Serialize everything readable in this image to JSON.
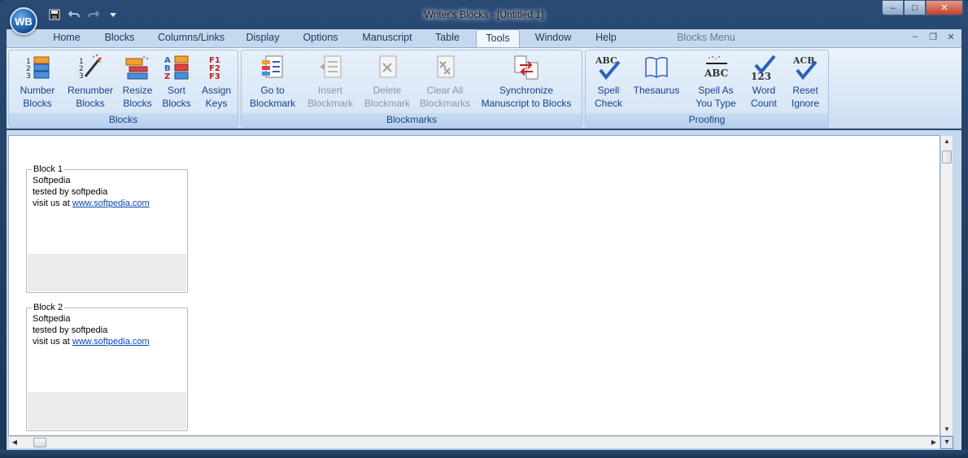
{
  "window": {
    "title": "Writer's Blocks - [Untitled 1]",
    "logo_text": "WB"
  },
  "quick_access": {
    "save_icon": "floppy-disk-icon",
    "undo_icon": "undo-arrow-icon",
    "redo_icon": "redo-arrow-icon",
    "customize_icon": "dropdown-arrow-icon"
  },
  "window_controls": {
    "minimize": "–",
    "maximize": "□",
    "close": "✕"
  },
  "tabs": [
    {
      "label": "Home"
    },
    {
      "label": "Blocks"
    },
    {
      "label": "Columns/Links"
    },
    {
      "label": "Display"
    },
    {
      "label": "Options"
    },
    {
      "label": "Manuscript"
    },
    {
      "label": "Table"
    },
    {
      "label": "Tools",
      "active": true
    },
    {
      "label": "Window"
    },
    {
      "label": "Help"
    },
    {
      "label": "Blocks Menu",
      "contextual": true
    }
  ],
  "mdi_controls": {
    "minimize": "–",
    "restore": "❐",
    "close": "✕"
  },
  "ribbon": {
    "groups": [
      {
        "label": "Blocks",
        "buttons": [
          {
            "line1": "Number",
            "line2": "Blocks",
            "icon": "number-blocks-icon"
          },
          {
            "line1": "Renumber",
            "line2": "Blocks",
            "icon": "renumber-blocks-icon"
          },
          {
            "line1": "Resize",
            "line2": "Blocks",
            "icon": "resize-blocks-icon"
          },
          {
            "line1": "Sort",
            "line2": "Blocks",
            "icon": "sort-blocks-icon"
          },
          {
            "line1": "Assign",
            "line2": "Keys",
            "icon": "assign-keys-icon"
          }
        ]
      },
      {
        "label": "Blockmarks",
        "buttons": [
          {
            "line1": "Go to",
            "line2": "Blockmark",
            "icon": "goto-blockmark-icon"
          },
          {
            "line1": "Insert",
            "line2": "Blockmark",
            "icon": "insert-blockmark-icon",
            "disabled": true
          },
          {
            "line1": "Delete",
            "line2": "Blockmark",
            "icon": "delete-blockmark-icon",
            "disabled": true
          },
          {
            "line1": "Clear All",
            "line2": "Blockmarks",
            "icon": "clear-blockmarks-icon",
            "disabled": true
          },
          {
            "line1": "Synchronize",
            "line2": "Manuscript to Blocks",
            "icon": "synchronize-icon"
          }
        ]
      },
      {
        "label": "Proofing",
        "buttons": [
          {
            "line1": "Spell",
            "line2": "Check",
            "icon": "spell-check-icon"
          },
          {
            "line1": "Thesaurus",
            "line2": "",
            "icon": "thesaurus-book-icon"
          },
          {
            "line1": "Spell As",
            "line2": "You Type",
            "icon": "spell-as-you-type-icon"
          },
          {
            "line1": "Word",
            "line2": "Count",
            "icon": "word-count-icon"
          },
          {
            "line1": "Reset",
            "line2": "Ignore",
            "icon": "reset-ignore-icon"
          }
        ]
      }
    ],
    "icon_glyphs": {
      "spell_abc": "ABC",
      "word_count_num": "123",
      "reset_acb": "ACB",
      "assign_f1": "F1",
      "assign_f2": "F2",
      "assign_f3": "F3",
      "sort_a": "A",
      "sort_b": "B",
      "sort_z": "Z"
    }
  },
  "blocks": [
    {
      "title": "Block 1",
      "line1": "Softpedia",
      "line2": "tested by softpedia",
      "line3_prefix": "visit us at ",
      "link": "www.softpedia.com"
    },
    {
      "title": "Block 2",
      "line1": "Softpedia",
      "line2": "tested by softpedia",
      "line3_prefix": "visit us at ",
      "link": "www.softpedia.com"
    }
  ],
  "colors": {
    "ribbon_text": "#15428b",
    "disabled_text": "#8c97a5",
    "link": "#0645ad"
  }
}
